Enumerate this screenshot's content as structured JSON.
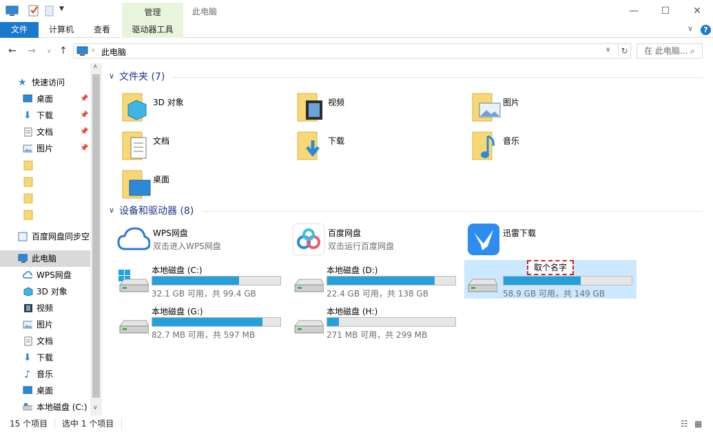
{
  "window": {
    "title": "此电脑",
    "context_tab_top": "管理",
    "minimize": "—",
    "maximize": "☐",
    "close": "✕"
  },
  "ribbon": {
    "file": "文件",
    "computer": "计算机",
    "view": "查看",
    "drive_tools": "驱动器工具",
    "expand": "∨",
    "help": "?"
  },
  "address": {
    "path_label": "此电脑",
    "search_placeholder": "在 此电脑..."
  },
  "nav": {
    "quick_access": "快速访问",
    "quick_items": [
      "桌面",
      "下载",
      "文档",
      "图片"
    ],
    "baidu_sync": "百度网盘同步空",
    "this_pc": "此电脑",
    "pc_items": [
      "WPS网盘",
      "3D 对象",
      "视频",
      "图片",
      "文档",
      "下载",
      "音乐",
      "桌面",
      "本地磁盘 (C:)"
    ]
  },
  "folders": {
    "header": "文件夹 (7)",
    "items": [
      "3D 对象",
      "视频",
      "图片",
      "文档",
      "下载",
      "音乐",
      "桌面"
    ]
  },
  "devices": {
    "header": "设备和驱动器 (8)",
    "apps": [
      {
        "name": "WPS网盘",
        "sub": "双击进入WPS网盘"
      },
      {
        "name": "百度网盘",
        "sub": "双击运行百度网盘"
      },
      {
        "name": "迅雷下载",
        "sub": ""
      }
    ],
    "drives": [
      {
        "name": "本地磁盘 (C:)",
        "free": "32.1 GB 可用，共 99.4 GB",
        "used_fraction": 0.68
      },
      {
        "name": "本地磁盘 (D:)",
        "free": "22.4 GB 可用，共 138 GB",
        "used_fraction": 0.84
      },
      {
        "name": "",
        "free": "58.9 GB 可用，共 149 GB",
        "used_fraction": 0.6,
        "rename_text": "取个名字"
      },
      {
        "name": "本地磁盘 (G:)",
        "free": "82.7 MB 可用，共 597 MB",
        "used_fraction": 0.86
      },
      {
        "name": "本地磁盘 (H:)",
        "free": "271 MB 可用，共 299 MB",
        "used_fraction": 0.09
      }
    ]
  },
  "status": {
    "items_count": "15 个项目",
    "selected": "选中 1 个项目"
  },
  "colors": {
    "accent": "#1979ca",
    "drive_fill": "#26a0da",
    "selection": "#cce8ff",
    "group_header": "#1e3287",
    "folder": "#f8d775"
  }
}
